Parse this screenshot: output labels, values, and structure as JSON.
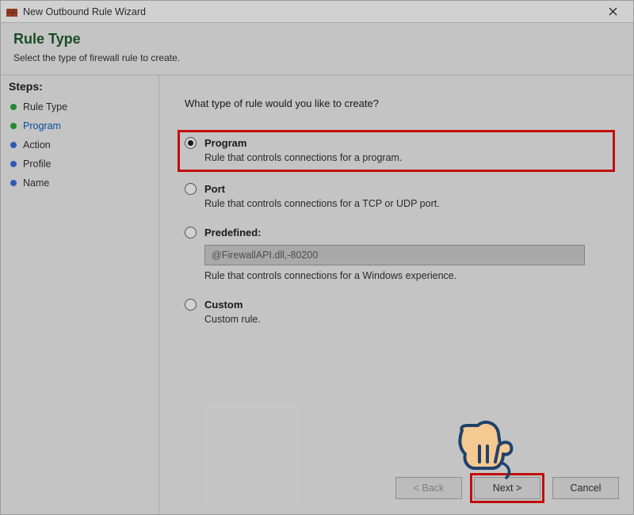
{
  "window": {
    "title": "New Outbound Rule Wizard",
    "close_tooltip": "Close"
  },
  "header": {
    "heading": "Rule Type",
    "subtext": "Select the type of firewall rule to create."
  },
  "sidebar": {
    "title": "Steps:",
    "items": [
      {
        "label": "Rule Type",
        "state": "done"
      },
      {
        "label": "Program",
        "state": "current"
      },
      {
        "label": "Action",
        "state": "pending"
      },
      {
        "label": "Profile",
        "state": "pending"
      },
      {
        "label": "Name",
        "state": "pending"
      }
    ]
  },
  "main": {
    "question": "What type of rule would you like to create?",
    "options": {
      "program": {
        "title": "Program",
        "desc": "Rule that controls connections for a program.",
        "selected": true
      },
      "port": {
        "title": "Port",
        "desc": "Rule that controls connections for a TCP or UDP port."
      },
      "predefined": {
        "title": "Predefined:",
        "select_value": "@FirewallAPI.dll,-80200",
        "desc": "Rule that controls connections for a Windows experience."
      },
      "custom": {
        "title": "Custom",
        "desc": "Custom rule."
      }
    }
  },
  "buttons": {
    "back": "< Back",
    "next": "Next >",
    "cancel": "Cancel"
  }
}
